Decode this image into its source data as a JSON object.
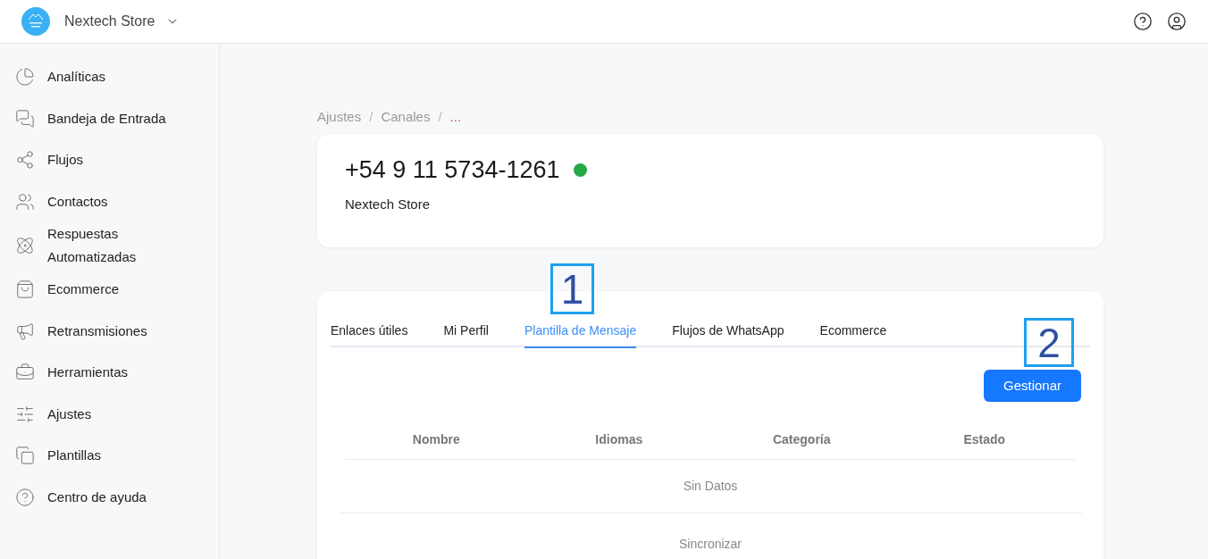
{
  "header": {
    "store_name": "Nextech Store"
  },
  "sidebar": {
    "items": [
      {
        "label": "Analíticas"
      },
      {
        "label": "Bandeja de Entrada"
      },
      {
        "label": "Flujos"
      },
      {
        "label": "Contactos"
      },
      {
        "label": "Respuestas Automatizadas"
      },
      {
        "label": "Ecommerce"
      },
      {
        "label": "Retransmisiones"
      },
      {
        "label": "Herramientas"
      },
      {
        "label": "Ajustes"
      },
      {
        "label": "Plantillas"
      },
      {
        "label": "Centro de ayuda"
      }
    ]
  },
  "breadcrumb": [
    {
      "label": "Ajustes",
      "separator": "/"
    },
    {
      "label": "Canales",
      "separator": "/"
    },
    {
      "label": "..."
    }
  ],
  "channel": {
    "phone": "+54 9 11 5734-1261",
    "connected": true,
    "name": "Nextech Store"
  },
  "tabs": [
    {
      "label": "Enlaces útiles",
      "selected": false
    },
    {
      "label": "Mi Perfil",
      "selected": false
    },
    {
      "label": "Plantilla de Mensaje",
      "selected": true
    },
    {
      "label": "Flujos de WhatsApp",
      "selected": false
    },
    {
      "label": "Ecommerce",
      "selected": false
    }
  ],
  "manage_button": "Gestionar",
  "table": {
    "columns": [
      "Nombre",
      "Idiomas",
      "Categoría",
      "Estado"
    ],
    "empty_text": "Sin Datos"
  },
  "sync_link": "Sincronizar",
  "callouts": [
    {
      "label": "1"
    },
    {
      "label": "2"
    }
  ]
}
